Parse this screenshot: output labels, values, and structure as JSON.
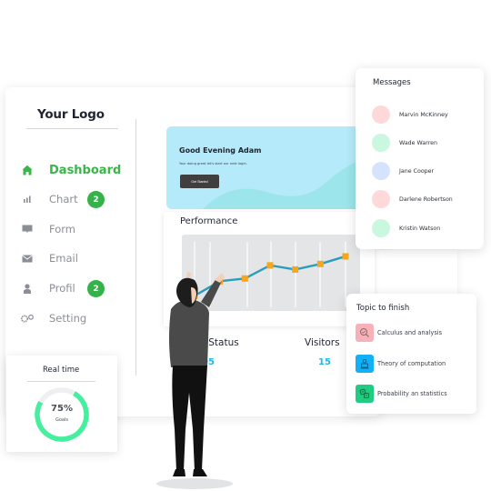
{
  "logo": {
    "text": "Your Logo"
  },
  "sidebar": {
    "items": [
      {
        "label": "Dashboard",
        "icon": "home-icon",
        "active": true
      },
      {
        "label": "Chart",
        "icon": "bar-chart-icon",
        "badge": "2"
      },
      {
        "label": "Form",
        "icon": "comment-icon"
      },
      {
        "label": "Email",
        "icon": "envelope-icon"
      },
      {
        "label": "Profil",
        "icon": "user-icon",
        "badge": "2"
      },
      {
        "label": "Setting",
        "icon": "gears-icon"
      }
    ]
  },
  "greeting": {
    "title": "Good Evening Adam",
    "subtitle": "Your doing great let's start our next login.",
    "button_label": "Get Started"
  },
  "performance": {
    "title": "Performance",
    "line_color": "#2a9dbb",
    "marker_color": "#f7a51c",
    "values": [
      2.2,
      4.3,
      4.7,
      6.6,
      6.0,
      6.8,
      7.9
    ],
    "y_range": [
      0,
      10
    ]
  },
  "stats": [
    {
      "label": "Project Status",
      "value": "05"
    },
    {
      "label": "Visitors",
      "value": "15"
    }
  ],
  "messages": {
    "title": "Messages",
    "items": [
      {
        "name": "Marvin McKinney",
        "avatar_color": "#ffd9da"
      },
      {
        "name": "Wade Warren",
        "avatar_color": "#c9f7df"
      },
      {
        "name": "Jane Cooper",
        "avatar_color": "#d5e3ff"
      },
      {
        "name": "Darlene Robertson",
        "avatar_color": "#ffd9da"
      },
      {
        "name": "Kristin Watson",
        "avatar_color": "#c9f7df"
      }
    ]
  },
  "topics": {
    "title": "Topic to finish",
    "items": [
      {
        "label": "Calculus and analysis",
        "icon": "magnifier-check-icon",
        "color": "#f7b2b9"
      },
      {
        "label": "Theory of computation",
        "icon": "computer-user-icon",
        "color": "#12b0f5"
      },
      {
        "label": "Probability an statistics",
        "icon": "dice-icon",
        "color": "#1fcc80"
      }
    ]
  },
  "realtime": {
    "title": "Real time",
    "value": "75%",
    "percent": 75,
    "caption": "Goals",
    "color": "#45ef9e"
  }
}
